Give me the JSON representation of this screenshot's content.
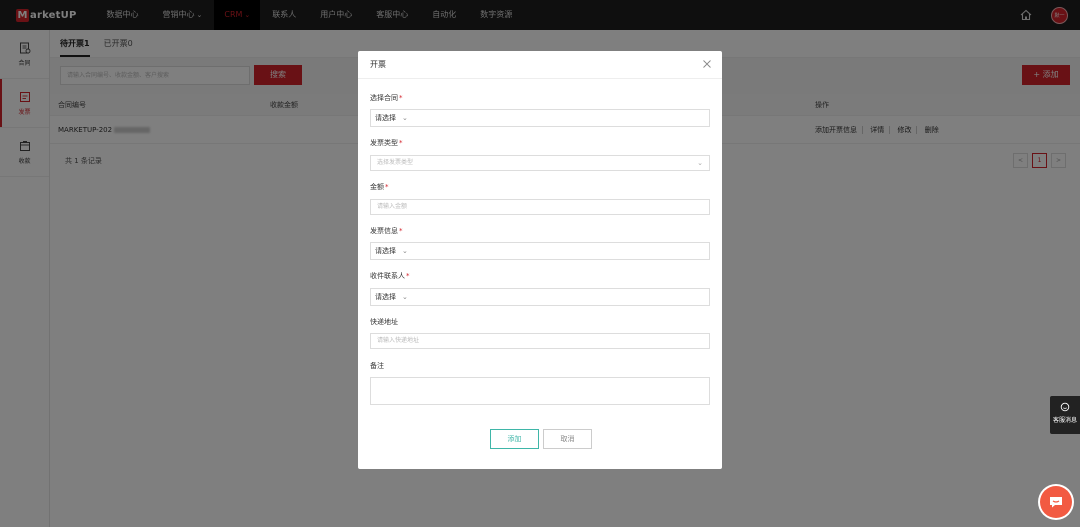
{
  "topbar": {
    "logo_mark": "M",
    "logo_text": "arketUP",
    "nav": [
      {
        "label": "数据中心",
        "chevron": false
      },
      {
        "label": "营销中心",
        "chevron": true
      },
      {
        "label": "CRM",
        "chevron": true
      },
      {
        "label": "联系人",
        "chevron": false
      },
      {
        "label": "用户中心",
        "chevron": false
      },
      {
        "label": "客服中心",
        "chevron": false
      },
      {
        "label": "自动化",
        "chevron": false
      },
      {
        "label": "数字资源",
        "chevron": false
      }
    ],
    "avatar_text": "默一"
  },
  "sidebar": {
    "items": [
      {
        "label": "合同",
        "icon": "contract-icon"
      },
      {
        "label": "发票",
        "icon": "invoice-icon"
      },
      {
        "label": "收款",
        "icon": "payment-icon"
      }
    ]
  },
  "main": {
    "tabs": [
      "待开票1",
      "已开票0"
    ],
    "search_placeholder": "请输入合同编号、收款金额、客户搜索",
    "search_button": "搜索",
    "add_button": "添加",
    "columns": [
      "合同编号",
      "收款金额",
      "操作"
    ],
    "row": {
      "contract_no": "MARKETUP-202",
      "ops": [
        "添加开票信息",
        "详情",
        "修改",
        "删除"
      ]
    },
    "record_count": "共 1 条记录",
    "pager": {
      "prev": "<",
      "current": "1",
      "next": ">"
    }
  },
  "float": {
    "cs_label": "客服消息"
  },
  "modal": {
    "title": "开票",
    "close": "×",
    "fields": {
      "contract": {
        "label": "选择合同",
        "value": "请选择"
      },
      "invoice_type": {
        "label": "发票类型",
        "placeholder": "选择发票类型"
      },
      "amount": {
        "label": "金额",
        "placeholder": "请输入金额"
      },
      "invoice_info": {
        "label": "发票信息",
        "value": "请选择"
      },
      "receiver": {
        "label": "收件联系人",
        "value": "请选择"
      },
      "address": {
        "label": "快递地址",
        "placeholder": "请输入快递地址"
      },
      "remark": {
        "label": "备注"
      }
    },
    "required_mark": "*",
    "ok_button": "添加",
    "cancel_button": "取消"
  }
}
